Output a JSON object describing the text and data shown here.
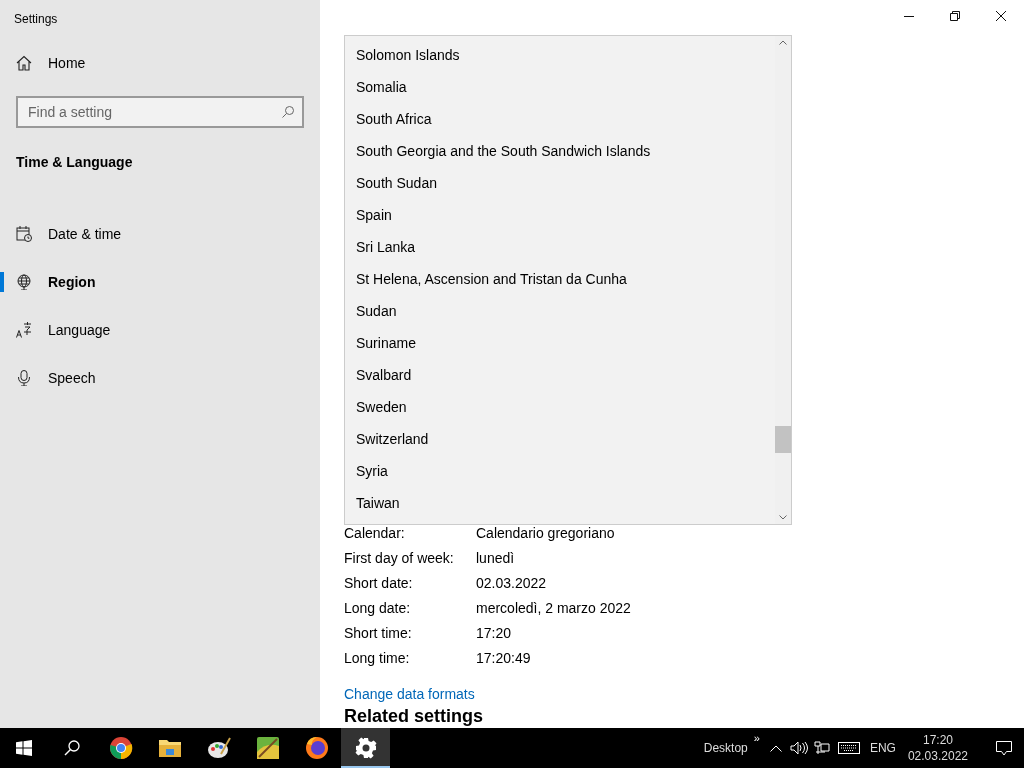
{
  "window": {
    "title": "Settings"
  },
  "sidebar": {
    "home": "Home",
    "search": {
      "placeholder": "Find a setting"
    },
    "section": "Time & Language",
    "items": [
      {
        "label": "Date & time",
        "selected": false
      },
      {
        "label": "Region",
        "selected": true
      },
      {
        "label": "Language",
        "selected": false
      },
      {
        "label": "Speech",
        "selected": false
      }
    ]
  },
  "dropdown": {
    "options": [
      {
        "label": "Solomon Islands",
        "selected": false
      },
      {
        "label": "Somalia",
        "selected": false
      },
      {
        "label": "South Africa",
        "selected": false
      },
      {
        "label": "South Georgia and the South Sandwich Islands",
        "selected": false
      },
      {
        "label": "South Sudan",
        "selected": false
      },
      {
        "label": "Spain",
        "selected": false
      },
      {
        "label": "Sri Lanka",
        "selected": false
      },
      {
        "label": "St Helena, Ascension and Tristan da Cunha",
        "selected": false
      },
      {
        "label": "Sudan",
        "selected": false
      },
      {
        "label": "Suriname",
        "selected": false
      },
      {
        "label": "Svalbard",
        "selected": false
      },
      {
        "label": "Sweden",
        "selected": false
      },
      {
        "label": "Switzerland",
        "selected": false
      },
      {
        "label": "Syria",
        "selected": false
      },
      {
        "label": "Taiwan",
        "selected": false
      }
    ]
  },
  "formats": [
    {
      "label": "Calendar:",
      "value": "Calendario gregoriano"
    },
    {
      "label": "First day of week:",
      "value": "lunedì"
    },
    {
      "label": "Short date:",
      "value": "02.03.2022"
    },
    {
      "label": "Long date:",
      "value": "mercoledì, 2 marzo 2022"
    },
    {
      "label": "Short time:",
      "value": "17:20"
    },
    {
      "label": "Long time:",
      "value": "17:20:49"
    }
  ],
  "change_link": "Change data formats",
  "related_heading": "Related settings",
  "taskbar": {
    "apps": [
      {
        "active": false
      },
      {
        "active": false
      },
      {
        "active": false
      },
      {
        "active": false
      },
      {
        "active": false
      },
      {
        "active": true
      }
    ],
    "toolbar": "Desktop",
    "toolbar_more": "»",
    "language": "ENG",
    "time": "17:20",
    "date": "02.03.2022"
  }
}
